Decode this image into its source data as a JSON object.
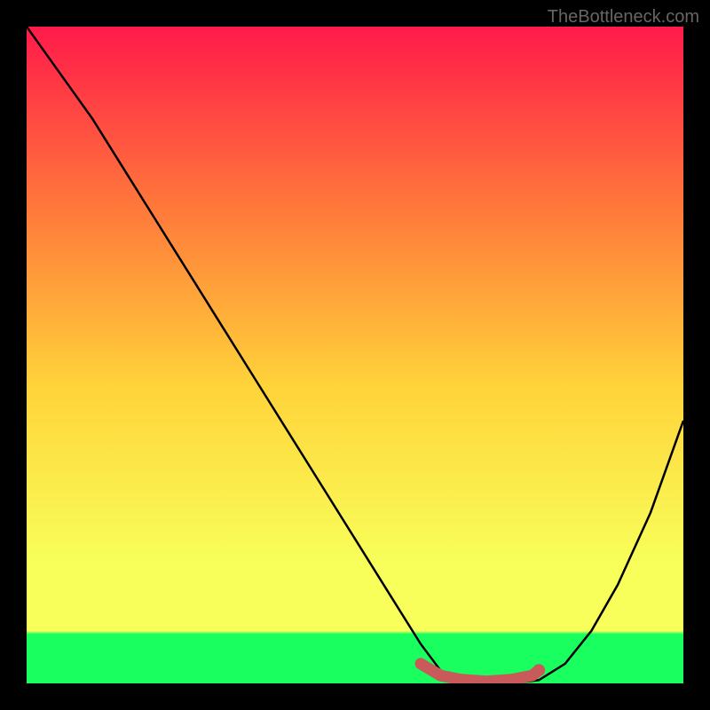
{
  "watermark": "TheBottleneck.com",
  "chart_data": {
    "type": "line",
    "title": "",
    "xlabel": "",
    "ylabel": "",
    "xlim": [
      0,
      100
    ],
    "ylim": [
      0,
      100
    ],
    "gradient_colors": {
      "top": "#ff1a4a",
      "upper_mid": "#ff7a3a",
      "mid": "#ffd43a",
      "lower_mid": "#f8ff5a",
      "bottom_band": "#1aff60"
    },
    "series": [
      {
        "name": "curve",
        "color": "#000000",
        "x": [
          0,
          5,
          10,
          15,
          20,
          25,
          30,
          35,
          40,
          45,
          50,
          55,
          60,
          63,
          66,
          70,
          74,
          78,
          82,
          86,
          90,
          95,
          100
        ],
        "y": [
          100,
          93,
          86,
          78,
          70,
          62,
          54,
          46,
          38,
          30,
          22,
          14,
          6,
          2,
          0.5,
          0,
          0,
          0.5,
          3,
          8,
          15,
          26,
          40
        ]
      },
      {
        "name": "optimal-zone",
        "color": "#c85a5a",
        "x": [
          60,
          63,
          66,
          70,
          74,
          77,
          78
        ],
        "y": [
          3,
          1.2,
          0.6,
          0.3,
          0.6,
          1.2,
          2
        ]
      }
    ],
    "optimal_point": {
      "x": 78,
      "y": 2
    }
  }
}
